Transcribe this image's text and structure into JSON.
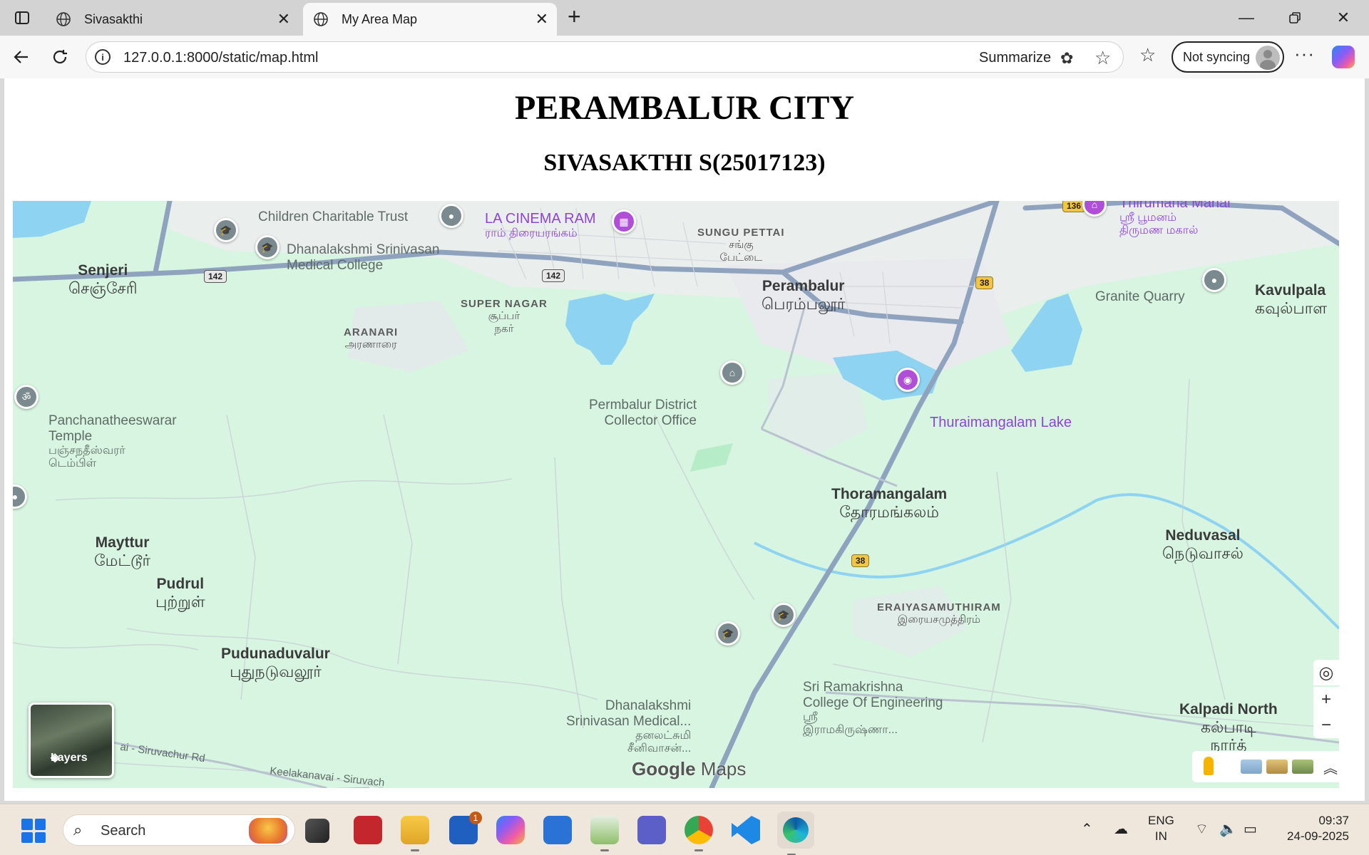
{
  "browser": {
    "tabs": [
      {
        "title": "Sivasakthi"
      },
      {
        "title": "My Area Map"
      }
    ],
    "url": "127.0.0.1:8000/static/map.html",
    "summarize_label": "Summarize",
    "sync_label": "Not syncing"
  },
  "page": {
    "title": "PERAMBALUR CITY",
    "subtitle": "SIVASAKTHI S(25017123)"
  },
  "map": {
    "places": {
      "children_trust": "Children Charitable Trust",
      "la_cinema": "LA CINEMA RAM",
      "la_cinema_ta": "ராம் திரையரங்கம்",
      "sungu_pettai": "SUNGU PETTAI",
      "sungu_pettai_ta1": "சங்கு",
      "sungu_pettai_ta2": "பேட்டை",
      "dhanalakshmi_mc_l1": "Dhanalakshmi Srinivasan",
      "dhanalakshmi_mc_l2": "Medical College",
      "senjeri": "Senjeri",
      "senjeri_ta": "செஞ்சேரி",
      "super_nagar": "SUPER NAGAR",
      "super_nagar_ta1": "சூப்பர்",
      "super_nagar_ta2": "நகர்",
      "aranari": "ARANARI",
      "aranari_ta": "அரணாரை",
      "perambalur": "Perambalur",
      "perambalur_ta": "பெரம்பலூர்",
      "granite_quarry": "Granite Quarry",
      "kavulpalayam": "Kavulpala",
      "kavulpalayam_ta": "கவுல்பாள",
      "thirumana_mahal": "Thirumana Mahal",
      "thirumana_ta1": "ஸ்ரீ பூமனம்",
      "thirumana_ta2": "திருமண மகால்",
      "panchanatheeswarar_l1": "Panchanatheeswarar",
      "panchanatheeswarar_l2": "Temple",
      "panchanatheeswarar_ta1": "பஞ்சநதீஸ்வரர்",
      "panchanatheeswarar_ta2": "டெம்பிள்",
      "collector_l1": "Permbalur District",
      "collector_l2": "Collector Office",
      "thuraimangalam_lake": "Thuraimangalam Lake",
      "thoramangalam": "Thoramangalam",
      "thoramangalam_ta": "தோரமங்கலம்",
      "mayttur": "Mayttur",
      "mayttur_ta": "மேட்டூர்",
      "pudrul": "Pudrul",
      "pudrul_ta": "புற்றுள்",
      "neduvasal": "Neduvasal",
      "neduvasal_ta": "நெடுவாசல்",
      "eraiyasamuthiram": "ERAIYASAMUTHIRAM",
      "eraiyasamuthiram_ta": "இரையசமுத்திரம்",
      "pudunaduvalur": "Pudunaduvalur",
      "pudunaduvalur_ta": "புதுநடுவலூர்",
      "src_l1": "Sri Ramakrishna",
      "src_l2": "College Of Engineering",
      "src_ta1": "ஸ்ரீ",
      "src_ta2": "இராமகிருஷ்ணா...",
      "dsm_l1": "Dhanalakshmi",
      "dsm_l2": "Srinivasan Medical...",
      "dsm_ta1": "தனலட்சுமி",
      "dsm_ta2": "சீனிவாசன்...",
      "kalpadi": "Kalpadi North",
      "kalpadi_ta1": "கல்பாடி",
      "kalpadi_ta2": "நார்த்",
      "siruvachur_rd": "ai - Siruvachur Rd",
      "keelakanavai": "Keelakanavai - Siruvach"
    },
    "road_shields": {
      "r142a": "142",
      "r142b": "142",
      "r38a": "38",
      "r38b": "38",
      "r136": "136"
    },
    "layers_label": "Layers",
    "brand": {
      "google": "Google",
      "maps": "Maps"
    }
  },
  "taskbar": {
    "search_label": "Search",
    "lang_line1": "ENG",
    "lang_line2": "IN",
    "time": "09:37",
    "date": "24-09-2025"
  }
}
